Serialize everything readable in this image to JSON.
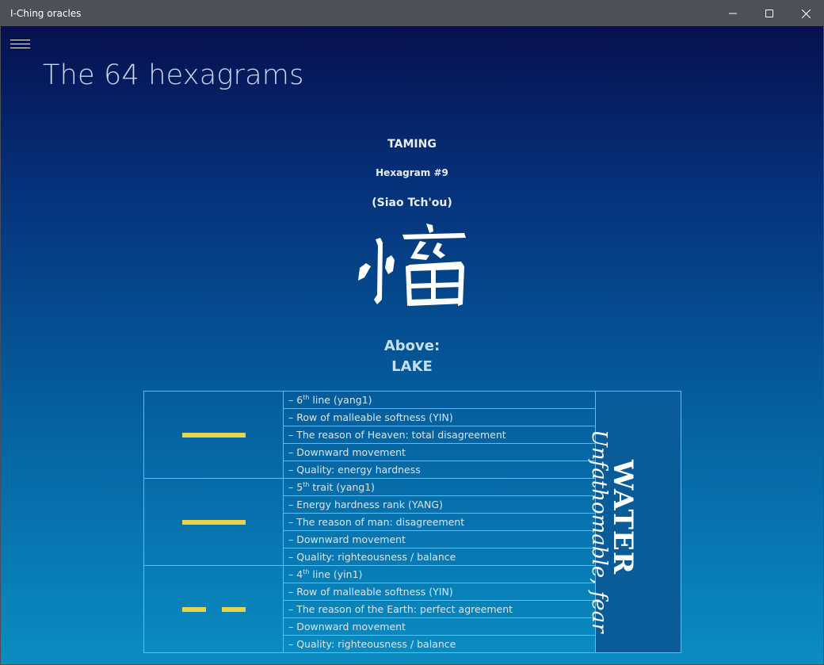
{
  "window": {
    "title": "I-Ching oracles"
  },
  "page": {
    "title": "The 64 hexagrams"
  },
  "hexagram": {
    "name": "TAMING",
    "number": "Hexagram #9",
    "romanization": "(Siao Tch'ou)",
    "calligraphy_alt": "小畜"
  },
  "above": {
    "label": "Above:",
    "value": "LAKE"
  },
  "trigram": {
    "name": "WATER",
    "description": "Unfathomable, fear"
  },
  "lines": [
    {
      "type": "yang",
      "rows": [
        {
          "pre": "– 6",
          "sup": "th",
          "post": " line (yang1)"
        },
        {
          "text": "– Row of malleable softness (YIN)"
        },
        {
          "text": "– The reason of Heaven: total disagreement"
        },
        {
          "text": "– Downward movement"
        },
        {
          "text": "– Quality: energy hardness"
        }
      ]
    },
    {
      "type": "yang",
      "rows": [
        {
          "pre": "– 5",
          "sup": "th",
          "post": " trait (yang1)"
        },
        {
          "text": "– Energy hardness rank (YANG)"
        },
        {
          "text": "– The reason of man: disagreement"
        },
        {
          "text": "– Downward movement"
        },
        {
          "text": "– Quality: righteousness / balance"
        }
      ]
    },
    {
      "type": "yin",
      "rows": [
        {
          "pre": "– 4",
          "sup": "th",
          "post": " line (yin1)"
        },
        {
          "text": "– Row of malleable softness (YIN)"
        },
        {
          "text": "– The reason of the Earth: perfect agreement"
        },
        {
          "text": "– Downward movement"
        },
        {
          "text": "– Quality: righteousness / balance"
        }
      ]
    }
  ],
  "colors": {
    "line_bar": "#e8d44a",
    "trigram_panel": "#0a5c98"
  }
}
